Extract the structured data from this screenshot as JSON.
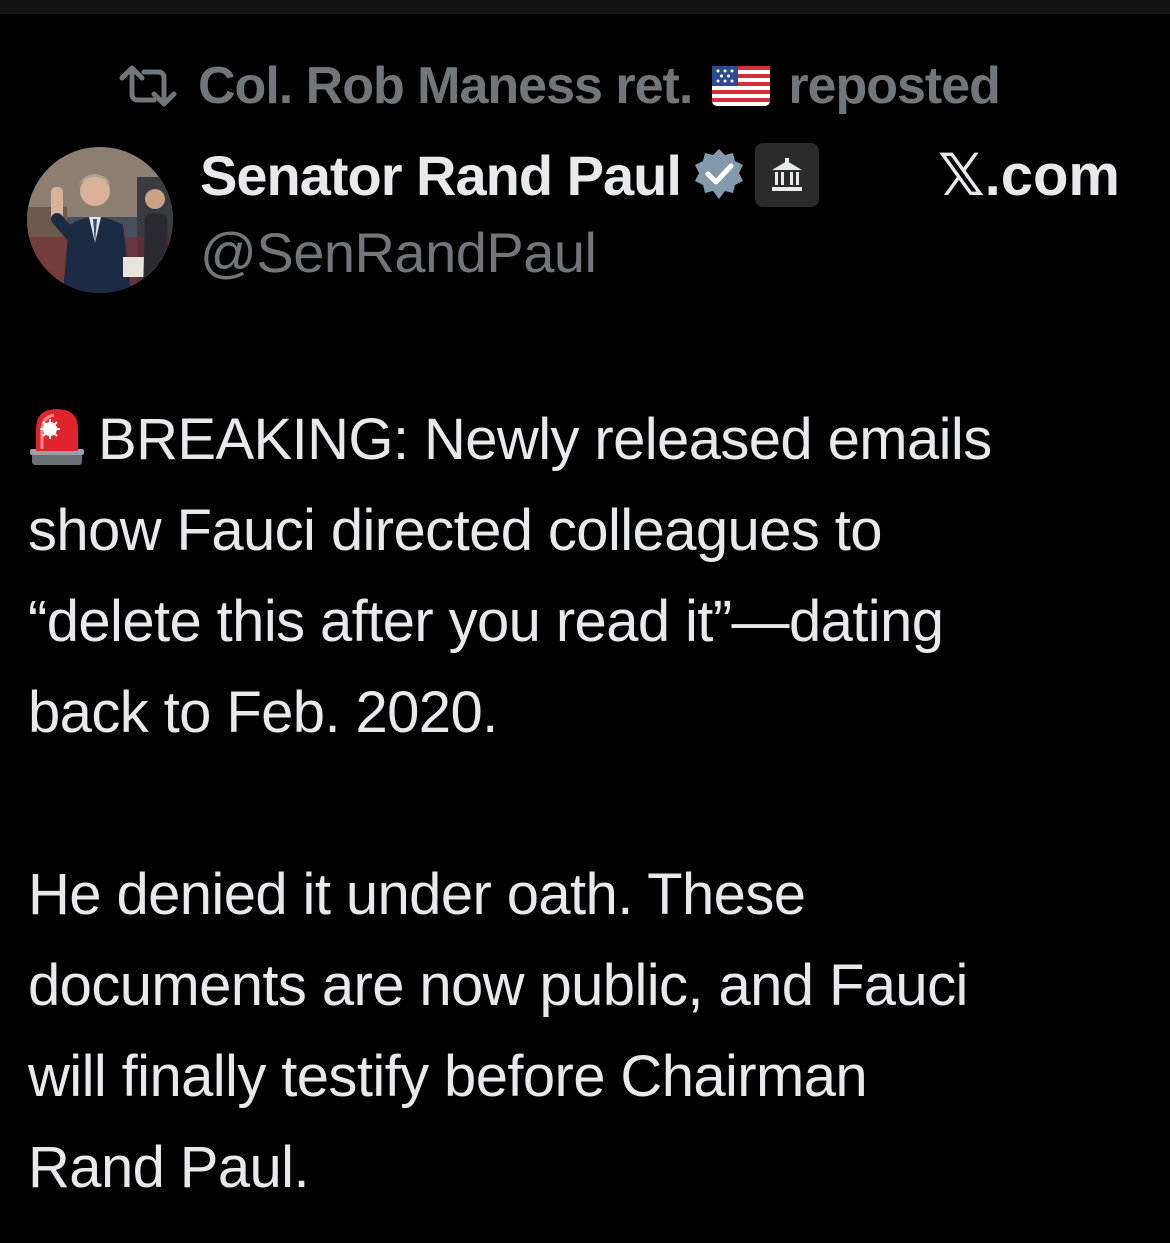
{
  "repost": {
    "reposter_name": "Col. Rob Maness ret.",
    "reposter_flag_icon": "us-flag-icon",
    "label": "reposted",
    "icon": "repost-icon"
  },
  "author": {
    "display_name": "Senator Rand Paul",
    "handle": "@SenRandPaul",
    "verified_icon": "verified-badge-icon",
    "affiliation_icon": "government-building-icon",
    "avatar": "avatar-photo"
  },
  "site_label": "𝕏.com",
  "post": {
    "alert_icon": "rotating-light-icon",
    "paragraph_1": "BREAKING: Newly released emails\nshow Fauci directed colleagues to\n“delete this after you read it”—dating\nback to Feb. 2020.",
    "paragraph_2": "He denied it under oath. These\ndocuments are now public, and Fauci\nwill finally testify before Chairman\nRand Paul."
  },
  "colors": {
    "background": "#000000",
    "primary_text": "#e7e9ea",
    "secondary_text": "#71767b",
    "verified": "#829aab"
  }
}
